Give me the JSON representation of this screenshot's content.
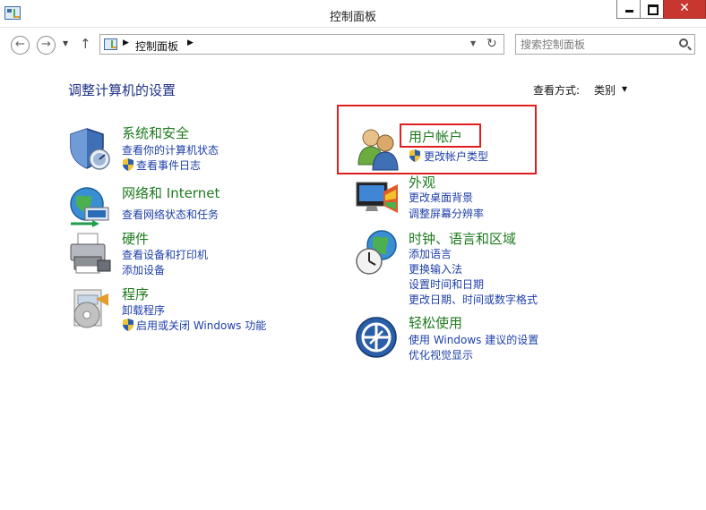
{
  "window": {
    "title": "控制面板",
    "close_label": "✕"
  },
  "address": {
    "path": "控制面板",
    "search_placeholder": "搜索控制面板"
  },
  "header": {
    "title": "调整计算机的设置",
    "view_by_label": "查看方式:",
    "view_by_value": "类别"
  },
  "categories": [
    {
      "title": "系统和安全",
      "links": [
        "查看你的计算机状态",
        "查看事件日志"
      ],
      "icon": "shield-security-icon"
    },
    {
      "title": "网络和 Internet",
      "links": [
        "查看网络状态和任务"
      ],
      "icon": "network-globe-icon"
    },
    {
      "title": "硬件",
      "links": [
        "查看设备和打印机",
        "添加设备"
      ],
      "icon": "printer-icon"
    },
    {
      "title": "程序",
      "links": [
        "卸载程序",
        "启用或关闭 Windows 功能"
      ],
      "icon": "programs-icon"
    },
    {
      "title": "用户帐户",
      "links": [
        "更改帐户类型"
      ],
      "icon": "users-icon"
    },
    {
      "title": "外观",
      "links": [
        "更改桌面背景",
        "调整屏幕分辨率"
      ],
      "icon": "appearance-icon"
    },
    {
      "title": "时钟、语言和区域",
      "links": [
        "添加语言",
        "更换输入法",
        "设置时间和日期",
        "更改日期、时间或数字格式"
      ],
      "icon": "clock-globe-icon"
    },
    {
      "title": "轻松使用",
      "links": [
        "使用 Windows 建议的设置",
        "优化视觉显示"
      ],
      "icon": "ease-of-access-icon"
    }
  ],
  "colors": {
    "category_title": "#1e7a1e",
    "link": "#1e3fa8",
    "heading": "#1e3287",
    "highlight": "#e01e1e"
  }
}
